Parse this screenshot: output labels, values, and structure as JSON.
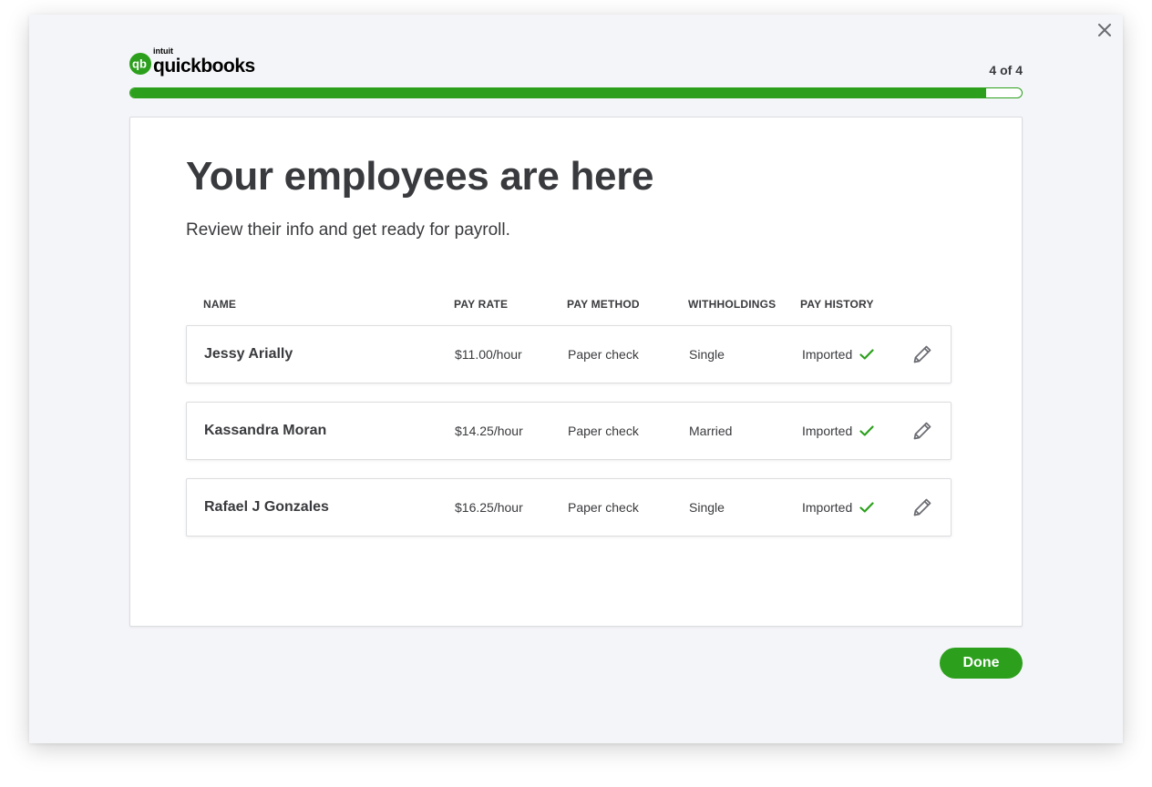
{
  "app": {
    "logo_small": "intuit",
    "logo_word": "quickbooks",
    "brand_color": "#2ca01c"
  },
  "progress": {
    "step_label": "4 of 4",
    "fraction": 0.96
  },
  "page": {
    "title": "Your employees are here",
    "subtitle": "Review their info and get ready for payroll."
  },
  "table": {
    "headers": {
      "name": "NAME",
      "pay_rate": "PAY RATE",
      "pay_method": "PAY METHOD",
      "withholdings": "WITHHOLDINGS",
      "pay_history": "PAY HISTORY"
    },
    "rows": [
      {
        "name": "Jessy Arially",
        "pay_rate": "$11.00/hour",
        "pay_method": "Paper check",
        "withholdings": "Single",
        "pay_history": "Imported"
      },
      {
        "name": "Kassandra Moran",
        "pay_rate": "$14.25/hour",
        "pay_method": "Paper check",
        "withholdings": "Married",
        "pay_history": "Imported"
      },
      {
        "name": "Rafael J Gonzales",
        "pay_rate": "$16.25/hour",
        "pay_method": "Paper check",
        "withholdings": "Single",
        "pay_history": "Imported"
      }
    ]
  },
  "footer": {
    "done_label": "Done"
  },
  "icons": {
    "close": "close-icon",
    "check": "check-icon",
    "edit": "pencil-icon",
    "logo": "quickbooks-logo-icon"
  }
}
